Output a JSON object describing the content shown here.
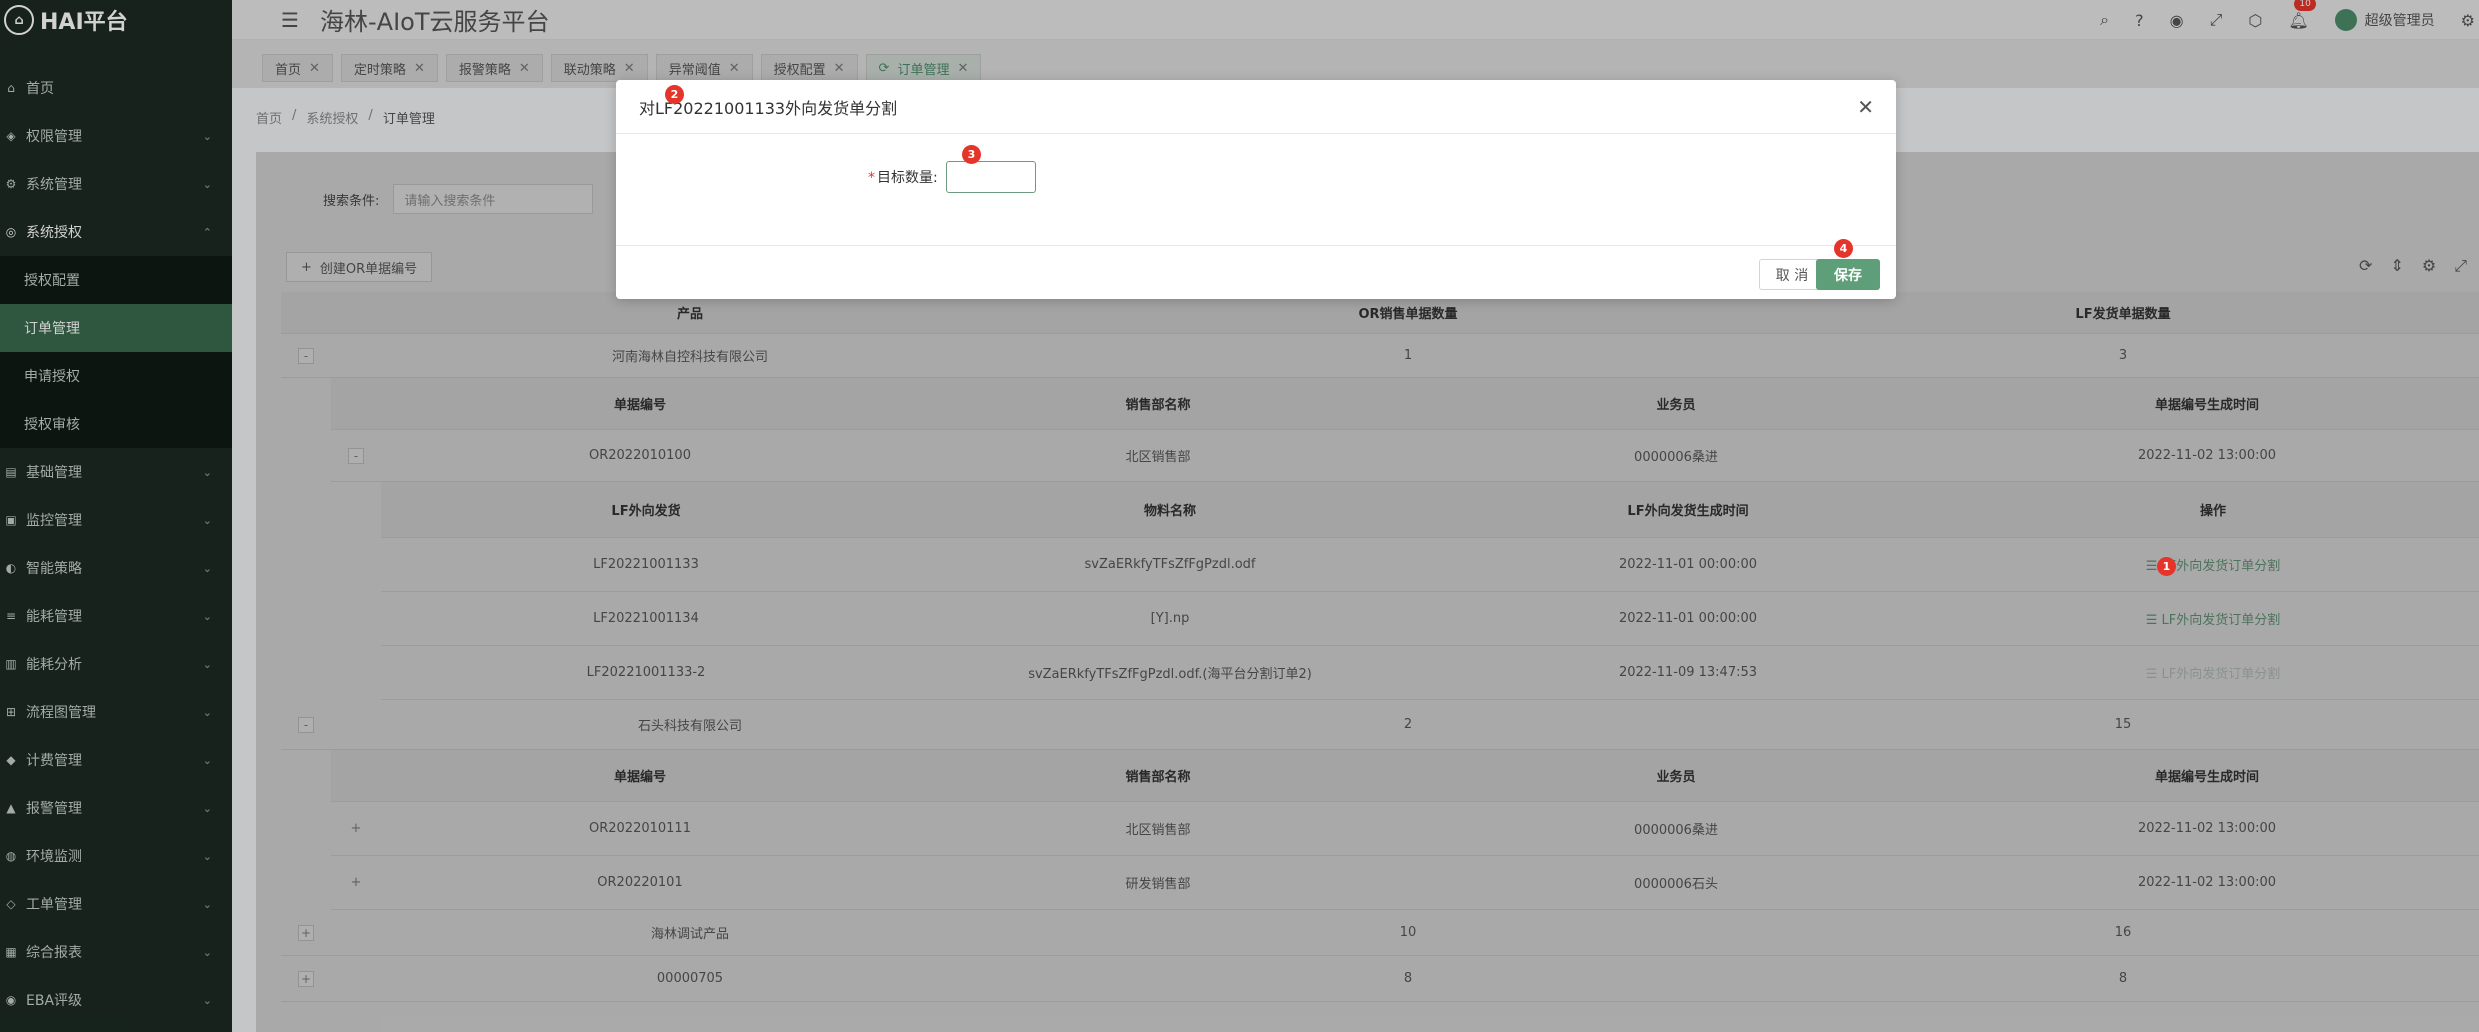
{
  "sidebar": {
    "logo": "HAI平台",
    "items": [
      {
        "label": "首页",
        "icon": "home-icon",
        "glyph": "⌂"
      },
      {
        "label": "权限管理",
        "icon": "shield-icon",
        "glyph": "◈"
      },
      {
        "label": "系统管理",
        "icon": "settings-icon",
        "glyph": "⚙"
      },
      {
        "label": "系统授权",
        "icon": "key-icon",
        "glyph": "◎"
      }
    ],
    "sub_items": [
      {
        "label": "授权配置"
      },
      {
        "label": "订单管理"
      },
      {
        "label": "申请授权"
      },
      {
        "label": "授权审核"
      }
    ],
    "more_items": [
      {
        "label": "基础管理",
        "icon": "base-icon",
        "glyph": "▤"
      },
      {
        "label": "监控管理",
        "icon": "monitor-icon",
        "glyph": "▣"
      },
      {
        "label": "智能策略",
        "icon": "strategy-icon",
        "glyph": "◐"
      },
      {
        "label": "能耗管理",
        "icon": "energy-icon",
        "glyph": "≡"
      },
      {
        "label": "能耗分析",
        "icon": "chart-icon",
        "glyph": "▥"
      },
      {
        "label": "流程图管理",
        "icon": "flow-icon",
        "glyph": "⊞"
      },
      {
        "label": "计费管理",
        "icon": "billing-icon",
        "glyph": "◆"
      },
      {
        "label": "报警管理",
        "icon": "alarm-icon",
        "glyph": "▲"
      },
      {
        "label": "环境监测",
        "icon": "env-icon",
        "glyph": "◍"
      },
      {
        "label": "工单管理",
        "icon": "ticket-icon",
        "glyph": "◇"
      },
      {
        "label": "综合报表",
        "icon": "report-icon",
        "glyph": "▦"
      },
      {
        "label": "EBA评级",
        "icon": "rating-icon",
        "glyph": "◉"
      }
    ]
  },
  "header": {
    "title": "海林-AIoT云服务平台",
    "badge": "10",
    "user": "超级管理员"
  },
  "tabs": [
    {
      "label": "首页"
    },
    {
      "label": "定时策略"
    },
    {
      "label": "报警策略"
    },
    {
      "label": "联动策略"
    },
    {
      "label": "异常阈值"
    },
    {
      "label": "授权配置"
    },
    {
      "label": "订单管理",
      "active": true
    }
  ],
  "breadcrumb": [
    "首页",
    "系统授权",
    "订单管理"
  ],
  "search": {
    "label": "搜索条件:",
    "placeholder": "请输入搜索条件"
  },
  "create_button": "创建OR单据编号",
  "table": {
    "columns": [
      "产品",
      "OR销售单据数量",
      "LF发货单据数量"
    ],
    "sub_columns": [
      "单据编号",
      "销售部名称",
      "业务员",
      "单据编号生成时间"
    ],
    "lf_columns": [
      "LF外向发货",
      "物料名称",
      "LF外向发货生成时间",
      "操作"
    ],
    "rows": [
      {
        "expander": "-",
        "product": "河南海林自控科技有限公司",
        "or_count": "1",
        "lf_count": "3",
        "orders": [
          {
            "expander": "-",
            "id": "OR2022010100",
            "dept": "北区销售部",
            "salesman": "0000006桑进",
            "time": "2022-11-02 13:00:00",
            "lf": [
              {
                "id": "LF20221001133",
                "material": "svZaERkfyTFsZfFgPzdl.odf",
                "time": "2022-11-01 00:00:00",
                "action": "LF外向发货订单分割",
                "disabled": false
              },
              {
                "id": "LF20221001134",
                "material": "[Y].np",
                "time": "2022-11-01 00:00:00",
                "action": "LF外向发货订单分割",
                "disabled": false
              },
              {
                "id": "LF20221001133-2",
                "material": "svZaERkfyTFsZfFgPzdl.odf.(海平台分割订单2)",
                "time": "2022-11-09 13:47:53",
                "action": "LF外向发货订单分割",
                "disabled": true
              }
            ]
          }
        ]
      },
      {
        "expander": "-",
        "product": "石头科技有限公司",
        "or_count": "2",
        "lf_count": "15",
        "orders": [
          {
            "expander": "+",
            "id": "OR2022010111",
            "dept": "北区销售部",
            "salesman": "0000006桑进",
            "time": "2022-11-02 13:00:00"
          },
          {
            "expander": "+",
            "id": "OR20220101",
            "dept": "研发销售部",
            "salesman": "0000006石头",
            "time": "2022-11-02 13:00:00"
          }
        ]
      },
      {
        "expander": "+",
        "product": "海林调试产品",
        "or_count": "10",
        "lf_count": "16"
      },
      {
        "expander": "+",
        "product": "00000705",
        "or_count": "8",
        "lf_count": "8"
      }
    ]
  },
  "dialog": {
    "title": "对LF20221001133外向发货单分割",
    "field_label": "目标数量:",
    "field_value": "",
    "cancel": "取 消",
    "save": "保存"
  },
  "markers": [
    "1",
    "2",
    "3",
    "4"
  ],
  "colors": {
    "accent": "#5e9e78",
    "sidebar_bg": "#1b2a22",
    "marker": "#e5352a"
  }
}
